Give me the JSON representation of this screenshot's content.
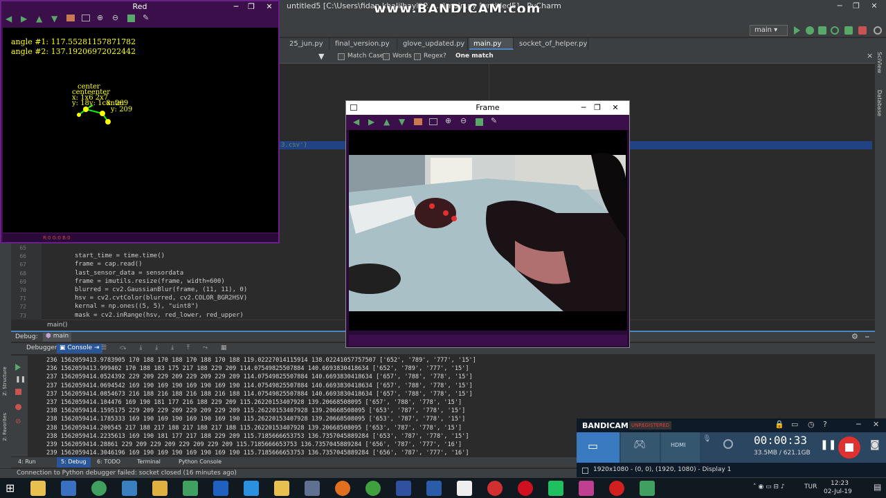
{
  "pycharm": {
    "title": "untitled5 [C:\\Users\\fidan khalilbayli\\P... ...\\main.py [untitled5] - PyCharm",
    "watermark": "www.BANDICAM.com",
    "run_config": "main",
    "tabs": [
      "25_jun.py",
      "final_version.py",
      "glove_updated.py",
      "main.py",
      "socket_of_helper.py"
    ],
    "active_tab": "main.py",
    "find": {
      "match_case": "Match Case",
      "words": "Words",
      "regex": "Regex",
      "help": "?",
      "result": "One match"
    },
    "editor_fragment": "3.csv')",
    "code_lines": [
      {
        "num": "65",
        "text": ""
      },
      {
        "num": "66",
        "text": "start_time = time.time()"
      },
      {
        "num": "67",
        "text": "frame = cap.read()"
      },
      {
        "num": "68",
        "text": "last_sensor_data = sensordata"
      },
      {
        "num": "69",
        "text": "frame = imutils.resize(frame, width=600)"
      },
      {
        "num": "70",
        "text": "blurred = cv2.GaussianBlur(frame, (11, 11), 0)"
      },
      {
        "num": "71",
        "text": "hsv = cv2.cvtColor(blurred, cv2.COLOR_BGR2HSV)"
      },
      {
        "num": "72",
        "text": "kernal = np.ones((5, 5), \"uint8\")"
      },
      {
        "num": "73",
        "text": "mask = cv2.inRange(hsv, red_lower, red_upper)"
      }
    ],
    "breadcrumb": "main()",
    "debug": {
      "label": "Debug:",
      "config": "main",
      "tab_debugger": "Debugger",
      "tab_console": "Console"
    },
    "console_lines": [
      "236 1562059413.9783905 170 188 170 188 170 188 170 188 119.02227014115914 138.02241057757507 ['652', '789', '777', '15']",
      "236 1562059413.999402 170 188 183 175 217 188 229 209 114.07549825507884 140.6693830418634 ['652', '789', '777', '15']",
      "237 1562059414.0524392 229 209 229 209 229 209 229 209 114.07549825507884 140.6693830418634 ['657', '788', '778', '15']",
      "237 1562059414.0694542 169 190 169 190 169 190 169 190 114.07549825507884 140.6693830418634 ['657', '788', '778', '15']",
      "237 1562059414.0854673 216 188 216 188 216 188 216 188 114.07549825507884 140.6693830418634 ['657', '788', '778', '15']",
      "237 1562059414.104476 169 190 181 177 216 188 229 209 115.26220153407928 139.20668508095 ['657', '788', '778', '15']",
      "238 1562059414.1595175 229 209 229 209 229 209 229 209 115.26220153407928 139.20668508095 ['653', '787', '778', '15']",
      "238 1562059414.1785333 169 190 169 190 169 190 169 190 115.26220153407928 139.20668508095 ['653', '787', '778', '15']",
      "238 1562059414.200545 217 188 217 188 217 188 217 188 115.26220153407928 139.20668508095 ['653', '787', '778', '15']",
      "238 1562059414.2235613 169 190 181 177 217 188 229 209 115.7185666653753 136.7357045889284 ['653', '787', '778', '15']",
      "239 1562059414.28861 229 209 229 209 229 209 229 209 115.7185666653753 136.7357045889284 ['656', '787', '777', '16']",
      "239 1562059414.3046196 169 190 169 190 169 190 169 190 115.7185666653753 136.7357045889284 ['656', '787', '777', '16']"
    ],
    "bottom_tabs": [
      "4: Run",
      "5: Debug",
      "6: TODO",
      "Terminal",
      "Python Console"
    ],
    "status": "Connection to Python debugger failed: socket closed (16 minutes ago)",
    "side_labels": {
      "structure": "Z: Structure",
      "favorites": "2: Favorites",
      "sciview": "SciView",
      "database": "Database"
    }
  },
  "red_window": {
    "title": "Red",
    "angle1": "angle #1: 117.55281157871782",
    "angle2": "angle #2: 137.19206972022442",
    "overlap_text": [
      "center",
      "centeenter",
      "x: 1x6 2x7",
      "y: 18y: 1c8nter",
      "x: 269",
      "y: 209"
    ],
    "status": "R:0 G:0 B:0"
  },
  "frame_window": {
    "title": "Frame"
  },
  "bandicam": {
    "brand": "BANDICAM",
    "badge": "UNREGISTERED",
    "timer": "00:00:33",
    "size": "33.5MB / 621.1GB",
    "resolution": "1920x1080 - (0, 0), (1920, 1080) - Display 1",
    "mode_hdmi": "HDMI"
  },
  "taskbar": {
    "lang": "TUR",
    "time": "12:23",
    "date": "02-Jul-19"
  }
}
